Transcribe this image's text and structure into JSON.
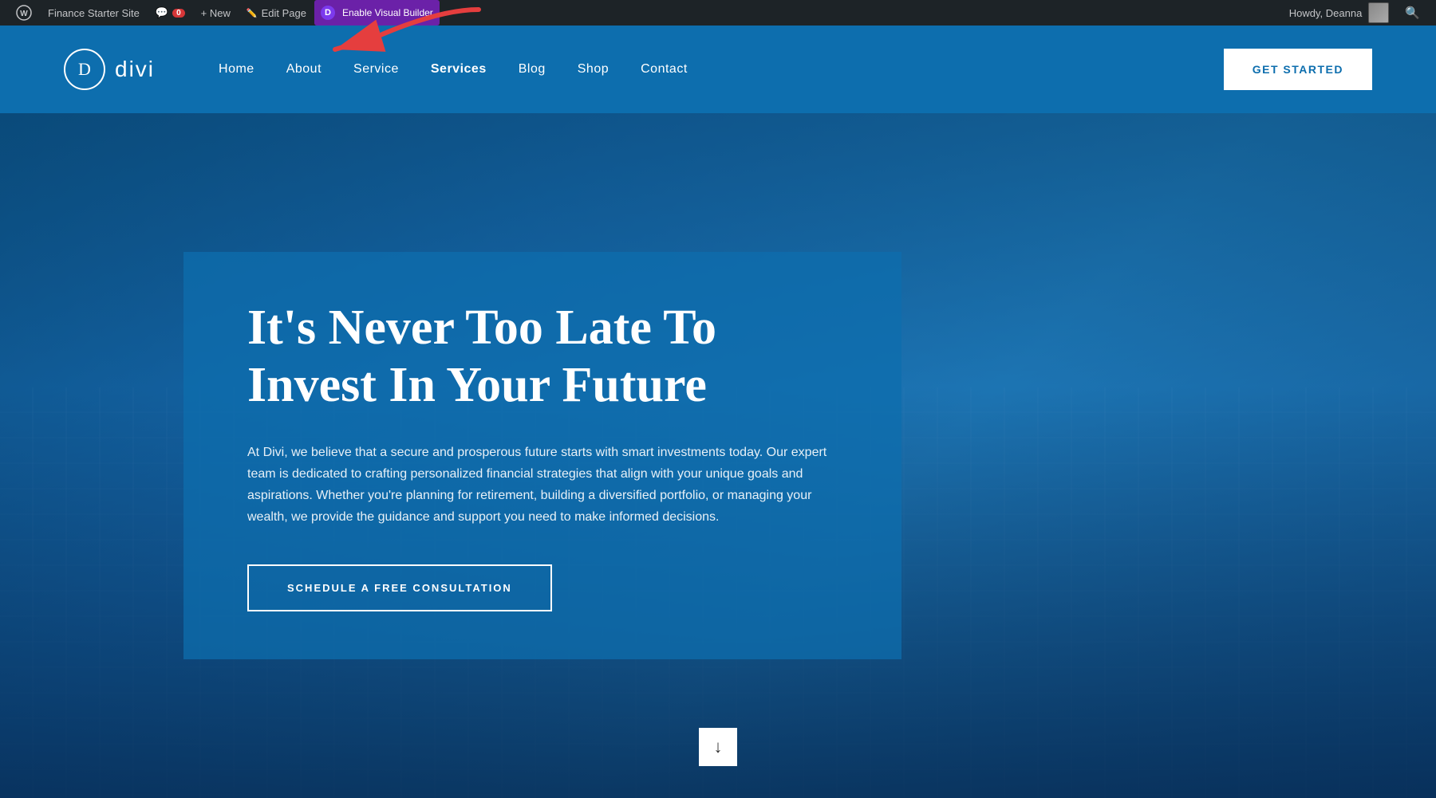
{
  "adminBar": {
    "siteName": "Finance Starter Site",
    "wpIcon": "W",
    "commentCount": "0",
    "newLabel": "+ New",
    "editLabel": "Edit Page",
    "diviLabel": "Enable Visual Builder",
    "howdy": "Howdy, Deanna",
    "searchIcon": "🔍"
  },
  "header": {
    "logoLetter": "D",
    "logoText": "divi",
    "nav": [
      {
        "label": "Home",
        "url": "#"
      },
      {
        "label": "About",
        "url": "#"
      },
      {
        "label": "Service",
        "url": "#"
      },
      {
        "label": "Services",
        "url": "#"
      },
      {
        "label": "Blog",
        "url": "#"
      },
      {
        "label": "Shop",
        "url": "#"
      },
      {
        "label": "Contact",
        "url": "#"
      }
    ],
    "ctaButton": "GET STARTED"
  },
  "hero": {
    "title": "It's Never Too Late To Invest In Your Future",
    "subtitle": "At Divi, we believe that a secure and prosperous future starts with smart investments today. Our expert team is dedicated to crafting personalized financial strategies that align with your unique goals and aspirations. Whether you're planning for retirement, building a diversified portfolio, or managing your wealth, we provide the guidance and support you need to make informed decisions.",
    "ctaButton": "SCHEDULE A FREE CONSULTATION",
    "scrollDownIcon": "↓"
  },
  "colors": {
    "adminBarBg": "#1d2327",
    "headerBg": "#0d6eae",
    "heroBg": "#1a6fb5",
    "ctaBorder": "#ffffff",
    "getStartedBg": "#ffffff",
    "getStartedColor": "#0d6eae"
  }
}
